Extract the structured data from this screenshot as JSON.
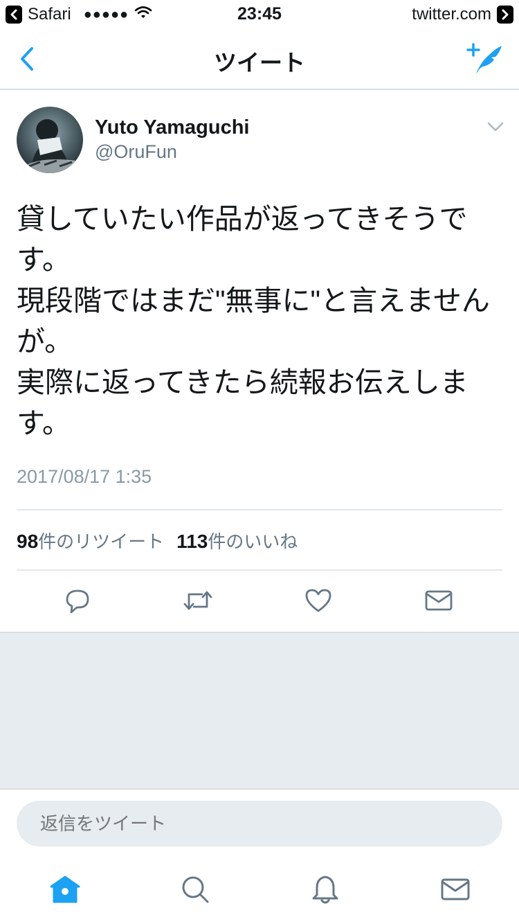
{
  "status_bar": {
    "back_app": "Safari",
    "signal": "●●●●●",
    "time": "23:45",
    "site": "twitter.com"
  },
  "nav": {
    "title": "ツイート",
    "back_icon": "chevron-left-icon",
    "compose_icon": "compose-tweet-icon"
  },
  "tweet": {
    "user": {
      "name": "Yuto Yamaguchi",
      "handle": "@OruFun"
    },
    "text": "貸していたい作品が返ってきそうで\nす。\n現段階ではまだ\"無事に\"と言えません\nが。\n実際に返ってきたら続報お伝えしま\nす。",
    "timestamp": "2017/08/17 1:35",
    "stats": {
      "retweet_count": "98",
      "retweet_label": "件のリツイート",
      "like_count": "113",
      "like_label": "件のいいね"
    },
    "actions": [
      "reply-icon",
      "retweet-icon",
      "like-icon",
      "direct-message-icon"
    ]
  },
  "reply": {
    "placeholder": "返信をツイート"
  },
  "tabbar": {
    "items": [
      "home-icon",
      "search-icon",
      "notifications-icon",
      "messages-icon"
    ],
    "active": "home-icon"
  },
  "colors": {
    "accent": "#1da1f2",
    "icon_gray": "#657786",
    "text": "#14171a",
    "muted": "#8899a6",
    "background_gray": "#e6ecf0"
  }
}
